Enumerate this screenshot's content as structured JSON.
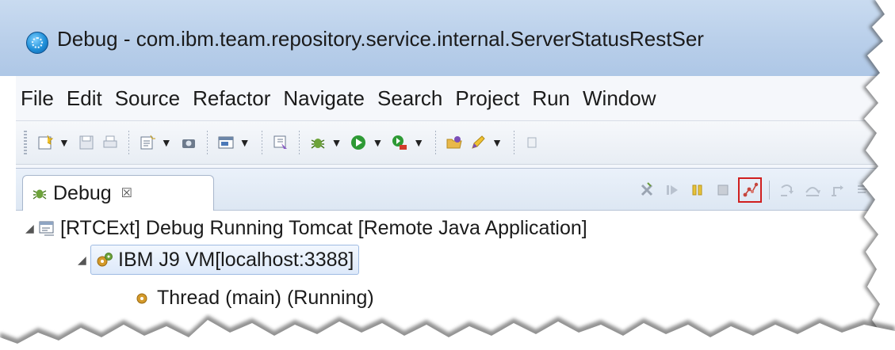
{
  "window": {
    "title": "Debug - com.ibm.team.repository.service.internal.ServerStatusRestSer"
  },
  "menubar": {
    "items": [
      "File",
      "Edit",
      "Source",
      "Refactor",
      "Navigate",
      "Search",
      "Project",
      "Run",
      "Window"
    ]
  },
  "toolbar": {
    "icons": [
      "new-icon",
      "save-icon",
      "print-icon",
      "new-class-icon",
      "snapshot-icon",
      "console-icon",
      "external-tools-icon",
      "debug-icon",
      "run-icon",
      "coverage-icon",
      "open-folder-icon",
      "pencil-icon"
    ]
  },
  "debug_view": {
    "tab_label": "Debug",
    "tab_close": "☒",
    "highlighted_tool": "disconnect-icon",
    "tree": [
      {
        "label": "[RTCExt] Debug Running Tomcat [Remote Java Application]",
        "expanded": true
      },
      {
        "label": "IBM J9 VM[localhost:3388]",
        "expanded": true,
        "selected": true
      },
      {
        "label": "Thread (main) (Running)"
      }
    ]
  },
  "colors": {
    "highlight_border": "#d01f1f",
    "selection_bg": "#dde9fa",
    "titlebar": "#c9dbf0"
  }
}
